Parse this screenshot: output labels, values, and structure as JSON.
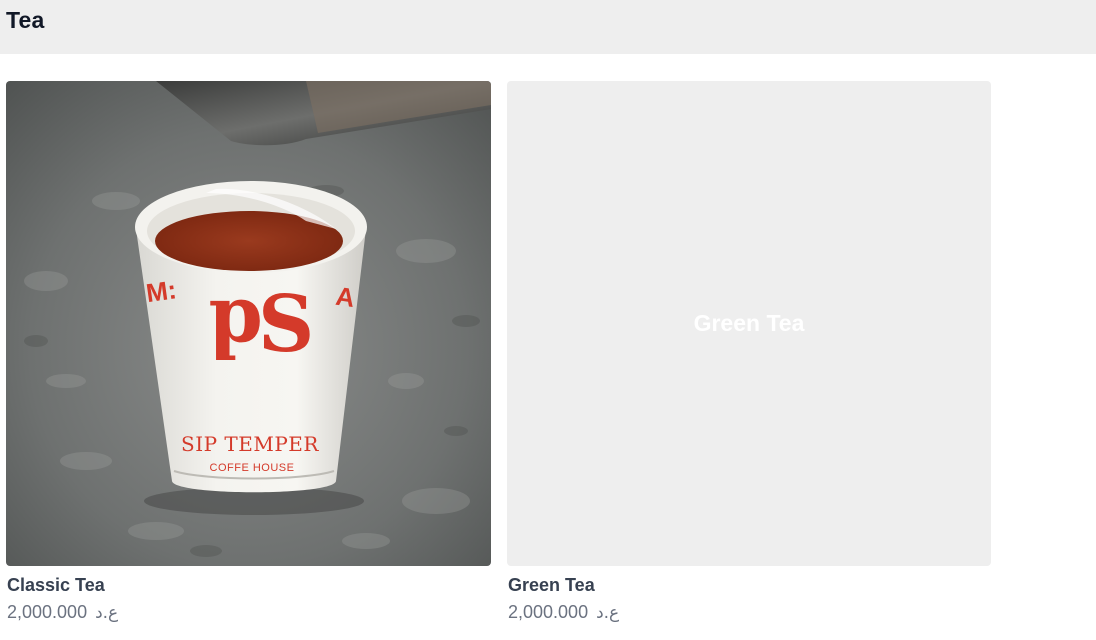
{
  "category": {
    "title": "Tea"
  },
  "products": [
    {
      "name": "Classic Tea",
      "price": "2,000.000",
      "currency": "ع.د",
      "image": "tea-cup-photo",
      "cup_print": {
        "logo": "SP",
        "brand": "SIP TEMPER",
        "sub": "COFFE HOUSE"
      }
    },
    {
      "name": "Green Tea",
      "price": "2,000.000",
      "currency": "ع.د",
      "image": "placeholder",
      "placeholder_text": "Green Tea"
    }
  ],
  "colors": {
    "header_bg": "#eeeeee",
    "placeholder_bg": "#eeeeee",
    "brand_red": "#d43a2a",
    "price_text": "#6b7280"
  }
}
